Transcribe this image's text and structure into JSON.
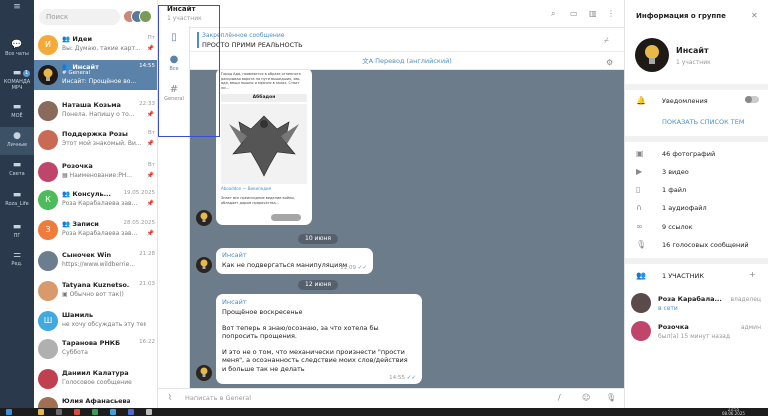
{
  "folders": [
    {
      "label": "Все чаты",
      "icon": "chat-bubble-icon"
    },
    {
      "label": "КОМАНДА МРЧ",
      "icon": "folder-icon",
      "badge": "1"
    },
    {
      "label": "МОЁ",
      "icon": "folder-icon"
    },
    {
      "label": "Личные",
      "icon": "person-icon"
    },
    {
      "label": "Света",
      "icon": "folder-icon"
    },
    {
      "label": "Roza_Life",
      "icon": "folder-icon"
    },
    {
      "label": "ПГ",
      "icon": "folder-icon"
    },
    {
      "label": "Ред.",
      "icon": "sliders-icon"
    }
  ],
  "search": {
    "placeholder": "Поиск"
  },
  "chats": [
    {
      "avatar_letter": "И",
      "avatar_color": "#f4a93b",
      "name": "Идеи",
      "preview": "Вы: Думаю, такие карт...",
      "time": "Пт",
      "pinned": true
    },
    {
      "avatar_letter": "",
      "avatar_color": "#1f1a16",
      "name": "Инсайт",
      "preview": "Инсайт: Прощёное во...",
      "topic": "# General",
      "time": "14:55",
      "pinned": false,
      "selected": true
    },
    {
      "avatar_letter": "",
      "avatar_color": "#8a6a5a",
      "name": "Наташа Козьма",
      "preview": "Понела. Напишу о то...",
      "time": "22:33",
      "pinned": true
    },
    {
      "avatar_letter": "",
      "avatar_color": "#c96a55",
      "name": "Поддержка Розы К...",
      "preview": "Этот мой знакомый. Ви...",
      "time": "Вт",
      "pinned": true
    },
    {
      "avatar_letter": "",
      "avatar_color": "#c0456a",
      "name": "Розочка",
      "preview": "Наименование:PH...",
      "time": "Вт",
      "pinned": true
    },
    {
      "avatar_letter": "К",
      "avatar_color": "#4cbc5b",
      "name": "Консуль...",
      "preview": "Роза Карабалаева зав...",
      "time": "19.05.2025",
      "pinned": true
    },
    {
      "avatar_letter": "З",
      "avatar_color": "#f07b3a",
      "name": "Записи",
      "preview": "Роза Карабалаева зав...",
      "time": "28.05.2025",
      "pinned": true
    },
    {
      "avatar_letter": "",
      "avatar_color": "#6b7d8e",
      "name": "Сыночек Win",
      "preview": "https://www.wildberrie...",
      "time": "21:28",
      "pinned": false
    },
    {
      "avatar_letter": "",
      "avatar_color": "#d89a6a",
      "name": "Tatyana Kuznetso...",
      "preview": "Обычно вот так))",
      "time": "21:03",
      "pinned": false
    },
    {
      "avatar_letter": "Ш",
      "avatar_color": "#3fa9e0",
      "name": "Шамиль",
      "preview": "не хочу обсуждать эту тему",
      "time": "",
      "pinned": false
    },
    {
      "avatar_letter": "",
      "avatar_color": "#b0b0b0",
      "name": "Таранова РНКБ",
      "preview": "Суббота",
      "time": "16:22",
      "pinned": false
    },
    {
      "avatar_letter": "",
      "avatar_color": "#c04050",
      "name": "Даниил Калатура",
      "preview": "Голосовое сообщение",
      "time": "",
      "pinned": false
    },
    {
      "avatar_letter": "",
      "avatar_color": "#a07050",
      "name": "Юлия Афанасьева",
      "preview": "",
      "time": "",
      "pinned": false
    }
  ],
  "topics": [
    {
      "label": "",
      "icon": "sidebar-toggle-icon"
    },
    {
      "label": "Все",
      "icon": "chat-bubbles-icon"
    },
    {
      "label": "General",
      "icon": "hash-icon"
    }
  ],
  "header": {
    "title": "Инсайт",
    "subtitle": "1 участник"
  },
  "pinned": {
    "title": "Закреплённое сообщение",
    "text": "ПРОСТО ПРИМИ РЕАЛЬНОСТЬ"
  },
  "translate": {
    "label": "Перевод (английский)"
  },
  "messages": [
    {
      "type": "image_post",
      "time": "",
      "text_top": "Город Ада, появляется в образе огненного раскрывая ворота на пути вышедших, явь ада, вещи пышно и мрачно в залах. Стоит ли...",
      "caption": "Аббадон",
      "link": "Aboaddon — Википедия",
      "text_bottom": "Знает все преисподние ведении войны, обладает даром пророчества..."
    },
    {
      "type": "date",
      "label": "10 июня"
    },
    {
      "type": "text",
      "sender": "Инсайт",
      "text": "Как не подвергаться манипуляциям",
      "time": "11:09"
    },
    {
      "type": "date",
      "label": "12 июня"
    },
    {
      "type": "text",
      "sender": "Инсайт",
      "paragraphs": [
        "Прощёное воскресенье",
        "Вот теперь я знаю/осознаю, за что хотела бы попросить прощения.",
        "И это не о том, что механически произнести \"прости меня\", а осознанность следствие моих слов/действия и больше так не делать"
      ],
      "time": "14:55"
    }
  ],
  "composer": {
    "placeholder": "Написать в General"
  },
  "group_info": {
    "panel_title": "Информация о группе",
    "name": "Инсайт",
    "members_count": "1 участник",
    "notifications_label": "Уведомления",
    "show_topics_label": "ПОКАЗАТЬ СПИСОК ТЕМ",
    "media": [
      {
        "icon": "photo-icon",
        "label": "46 фотографий"
      },
      {
        "icon": "video-icon",
        "label": "3 видео"
      },
      {
        "icon": "file-icon",
        "label": "1 файл"
      },
      {
        "icon": "headphones-icon",
        "label": "1 аудиофайл"
      },
      {
        "icon": "link-icon",
        "label": "9 ссылок"
      },
      {
        "icon": "microphone-icon",
        "label": "16 голосовых сообщений"
      }
    ],
    "members_header": "1 УЧАСТНИК",
    "members": [
      {
        "name": "Роза Карабала...",
        "status": "в сети",
        "role": "владелец",
        "avatar_color": "#5a4a4a"
      },
      {
        "name": "Розочка",
        "status": "был(а) 15 минут назад",
        "role": "админ",
        "avatar_color": "#c0456a"
      }
    ]
  },
  "taskbar": {
    "time": "23:55",
    "date": "08.06.2025"
  },
  "colors": {
    "folder_bg": "#2a3a4c",
    "selected_chat": "#5b82a8",
    "accent": "#4a90c6",
    "chat_bg": "#6d7c8b",
    "highlight_box": "#3a4fd6"
  }
}
